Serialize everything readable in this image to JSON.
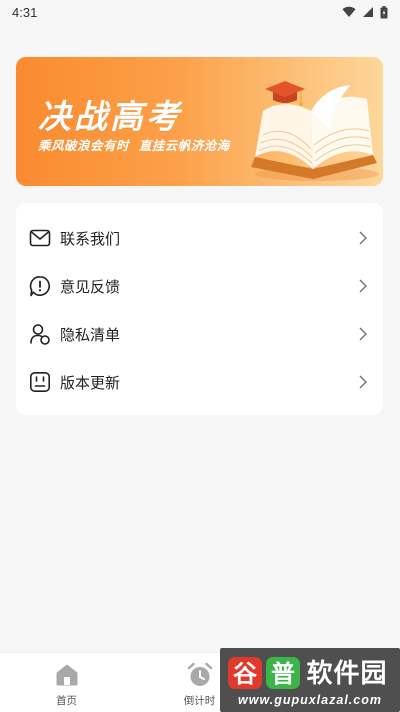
{
  "status": {
    "time": "4:31"
  },
  "banner": {
    "title": "决战高考",
    "subtitle": "乘风破浪会有时  直挂云帆济沧海"
  },
  "menu": {
    "items": [
      {
        "label": "联系我们",
        "icon": "mail-icon"
      },
      {
        "label": "意见反馈",
        "icon": "feedback-icon"
      },
      {
        "label": "隐私清单",
        "icon": "privacy-icon"
      },
      {
        "label": "版本更新",
        "icon": "version-icon"
      }
    ]
  },
  "bottom_nav": {
    "items": [
      {
        "label": "首页",
        "icon": "home-icon"
      },
      {
        "label": "倒计时",
        "icon": "alarm-clock-icon"
      }
    ]
  },
  "watermark": {
    "logo_text": "谷普软件园",
    "url": "www.gupuxlazal.com"
  },
  "colors": {
    "banner_start": "#fa8a2f",
    "banner_end": "#fdd79a",
    "watermark_red": "#e3392d",
    "watermark_green": "#3bb54a"
  }
}
